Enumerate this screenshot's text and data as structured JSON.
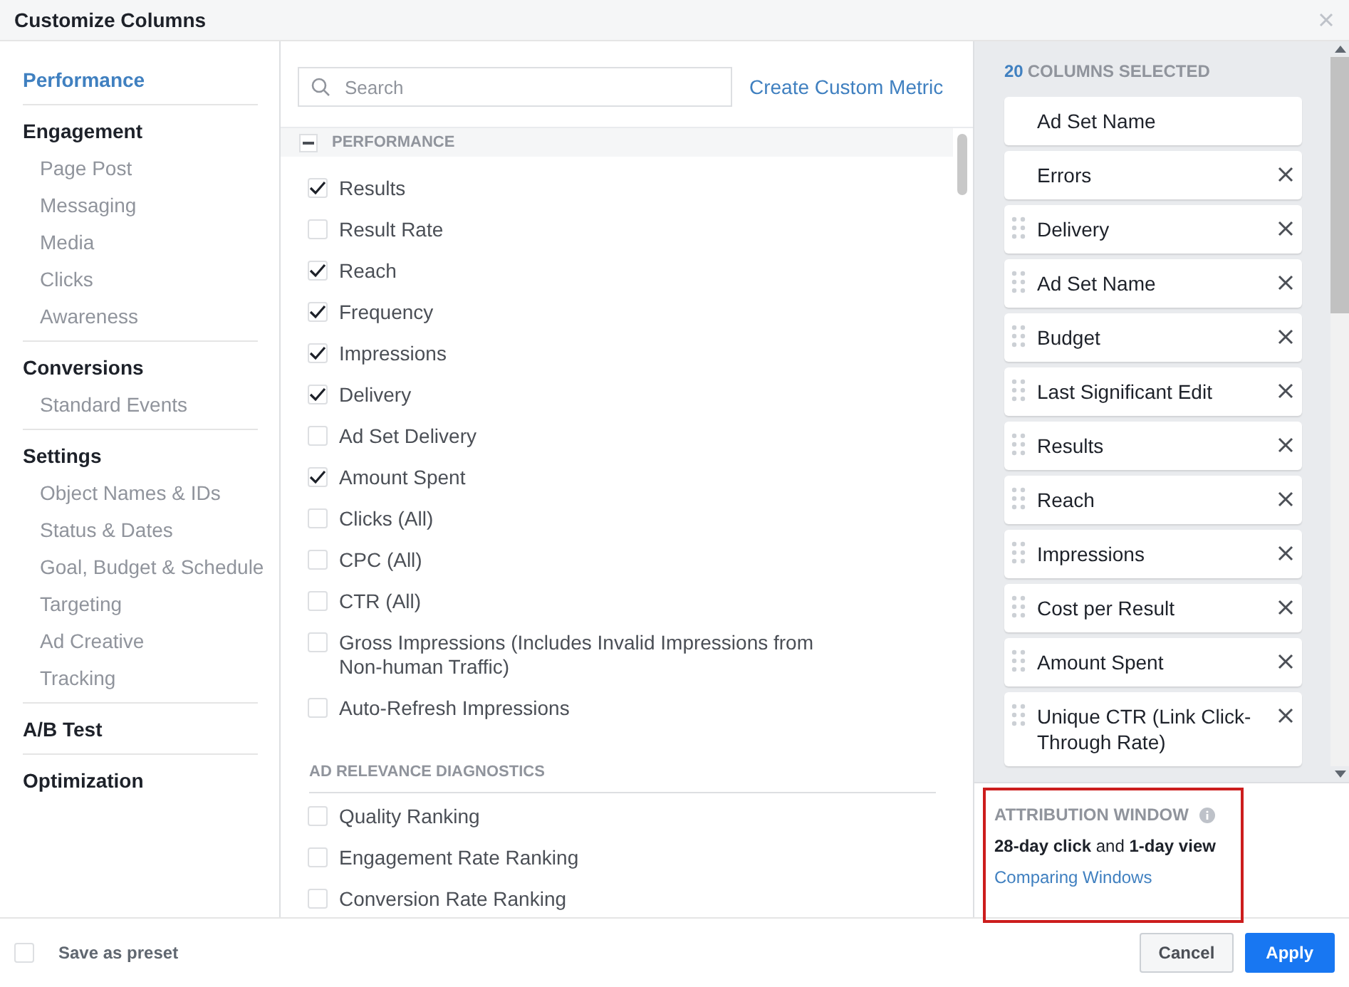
{
  "window": {
    "title": "Customize Columns"
  },
  "sidebar": {
    "items": [
      {
        "label": "Performance",
        "selected": true
      },
      {
        "label": "Engagement",
        "selected": false,
        "children": [
          {
            "label": "Page Post",
            "selected": false
          },
          {
            "label": "Messaging",
            "selected": false
          },
          {
            "label": "Media",
            "selected": false
          },
          {
            "label": "Clicks",
            "selected": false
          },
          {
            "label": "Awareness",
            "selected": false
          }
        ]
      },
      {
        "label": "Conversions",
        "selected": false,
        "children": [
          {
            "label": "Standard Events",
            "selected": false
          }
        ]
      },
      {
        "label": "Settings",
        "selected": false,
        "children": [
          {
            "label": "Object Names & IDs",
            "selected": false
          },
          {
            "label": "Status & Dates",
            "selected": false
          },
          {
            "label": "Goal, Budget & Schedule",
            "selected": false
          },
          {
            "label": "Targeting",
            "selected": false
          },
          {
            "label": "Ad Creative",
            "selected": false
          },
          {
            "label": "Tracking",
            "selected": false
          }
        ]
      },
      {
        "label": "A/B Test",
        "selected": false
      },
      {
        "label": "Optimization",
        "selected": false
      }
    ]
  },
  "search": {
    "placeholder": "Search"
  },
  "create_link": "Create Custom Metric",
  "sections": [
    {
      "title": "PERFORMANCE",
      "kind": "collapsible",
      "expanded": true,
      "metrics": [
        {
          "label": "Results",
          "checked": true
        },
        {
          "label": "Result Rate",
          "checked": false
        },
        {
          "label": "Reach",
          "checked": true
        },
        {
          "label": "Frequency",
          "checked": true
        },
        {
          "label": "Impressions",
          "checked": true
        },
        {
          "label": "Delivery",
          "checked": true
        },
        {
          "label": "Ad Set Delivery",
          "checked": false
        },
        {
          "label": "Amount Spent",
          "checked": true
        },
        {
          "label": "Clicks (All)",
          "checked": false
        },
        {
          "label": "CPC (All)",
          "checked": false
        },
        {
          "label": "CTR (All)",
          "checked": false
        },
        {
          "label": "Gross Impressions (Includes Invalid Impressions from Non-human Traffic)",
          "checked": false
        },
        {
          "label": "Auto-Refresh Impressions",
          "checked": false
        }
      ]
    },
    {
      "title": "AD RELEVANCE DIAGNOSTICS",
      "kind": "subsection",
      "metrics": [
        {
          "label": "Quality Ranking",
          "checked": false
        },
        {
          "label": "Engagement Rate Ranking",
          "checked": false
        },
        {
          "label": "Conversion Rate Ranking",
          "checked": false
        }
      ]
    }
  ],
  "selected_columns": {
    "count": "20",
    "label": "COLUMNS SELECTED",
    "items": [
      {
        "label": "Ad Set Name",
        "draggable": false,
        "removable": false
      },
      {
        "label": "Errors",
        "draggable": false,
        "removable": true
      },
      {
        "label": "Delivery",
        "draggable": true,
        "removable": true
      },
      {
        "label": "Ad Set Name",
        "draggable": true,
        "removable": true
      },
      {
        "label": "Budget",
        "draggable": true,
        "removable": true
      },
      {
        "label": "Last Significant Edit",
        "draggable": true,
        "removable": true
      },
      {
        "label": "Results",
        "draggable": true,
        "removable": true
      },
      {
        "label": "Reach",
        "draggable": true,
        "removable": true
      },
      {
        "label": "Impressions",
        "draggable": true,
        "removable": true
      },
      {
        "label": "Cost per Result",
        "draggable": true,
        "removable": true
      },
      {
        "label": "Amount Spent",
        "draggable": true,
        "removable": true
      },
      {
        "label": "Unique CTR (Link Click-Through Rate)",
        "draggable": true,
        "removable": true
      }
    ]
  },
  "attribution": {
    "title": "ATTRIBUTION WINDOW",
    "setting": "**28-day click** and **1-day view**",
    "link": "Comparing Windows",
    "highlighted": true
  },
  "footer": {
    "save_preset": {
      "label": "Save as preset",
      "checked": false
    },
    "buttons": [
      {
        "label": "Cancel",
        "kind": "secondary"
      },
      {
        "label": "Apply",
        "kind": "primary"
      }
    ]
  }
}
